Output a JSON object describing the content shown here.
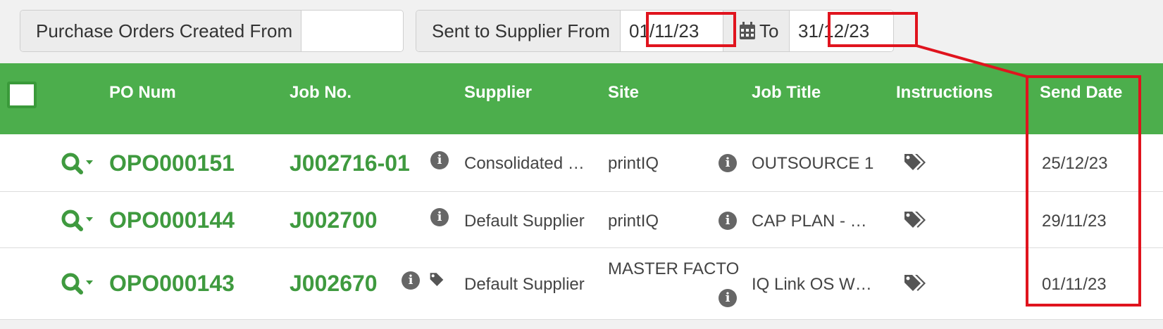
{
  "filters": {
    "created_from_label": "Purchase Orders Created From",
    "created_from_value": "",
    "sent_from_label": "Sent to Supplier From",
    "sent_from_value": "01/11/23",
    "to_label": "To",
    "to_value": "31/12/23"
  },
  "table": {
    "headers": {
      "po_num": "PO Num",
      "job_no": "Job No.",
      "supplier": "Supplier",
      "site": "Site",
      "job_title": "Job Title",
      "instructions": "Instructions",
      "send_date": "Send Date"
    },
    "rows": [
      {
        "po": "OPO000151",
        "job": "J002716-01",
        "supplier": "Consolidated …",
        "site": "printIQ",
        "job_title": "OUTSOURCE 1",
        "send_date": "25/12/23"
      },
      {
        "po": "OPO000144",
        "job": "J002700",
        "supplier": "Default Supplier",
        "site": "printIQ",
        "job_title": "CAP PLAN - …",
        "send_date": "29/11/23"
      },
      {
        "po": "OPO000143",
        "job": "J002670",
        "supplier": "Default Supplier",
        "site": "MASTER FACTO",
        "job_title": "IQ Link OS W…",
        "send_date": "01/11/23"
      }
    ]
  },
  "icons": {
    "info": "i",
    "row_action": "search-icon",
    "calendar": "calendar-icon",
    "instructions": "tag-icon"
  },
  "colors": {
    "header_green": "#4cae4c",
    "link_green": "#3f9a3f",
    "highlight_red": "#e0141e"
  }
}
